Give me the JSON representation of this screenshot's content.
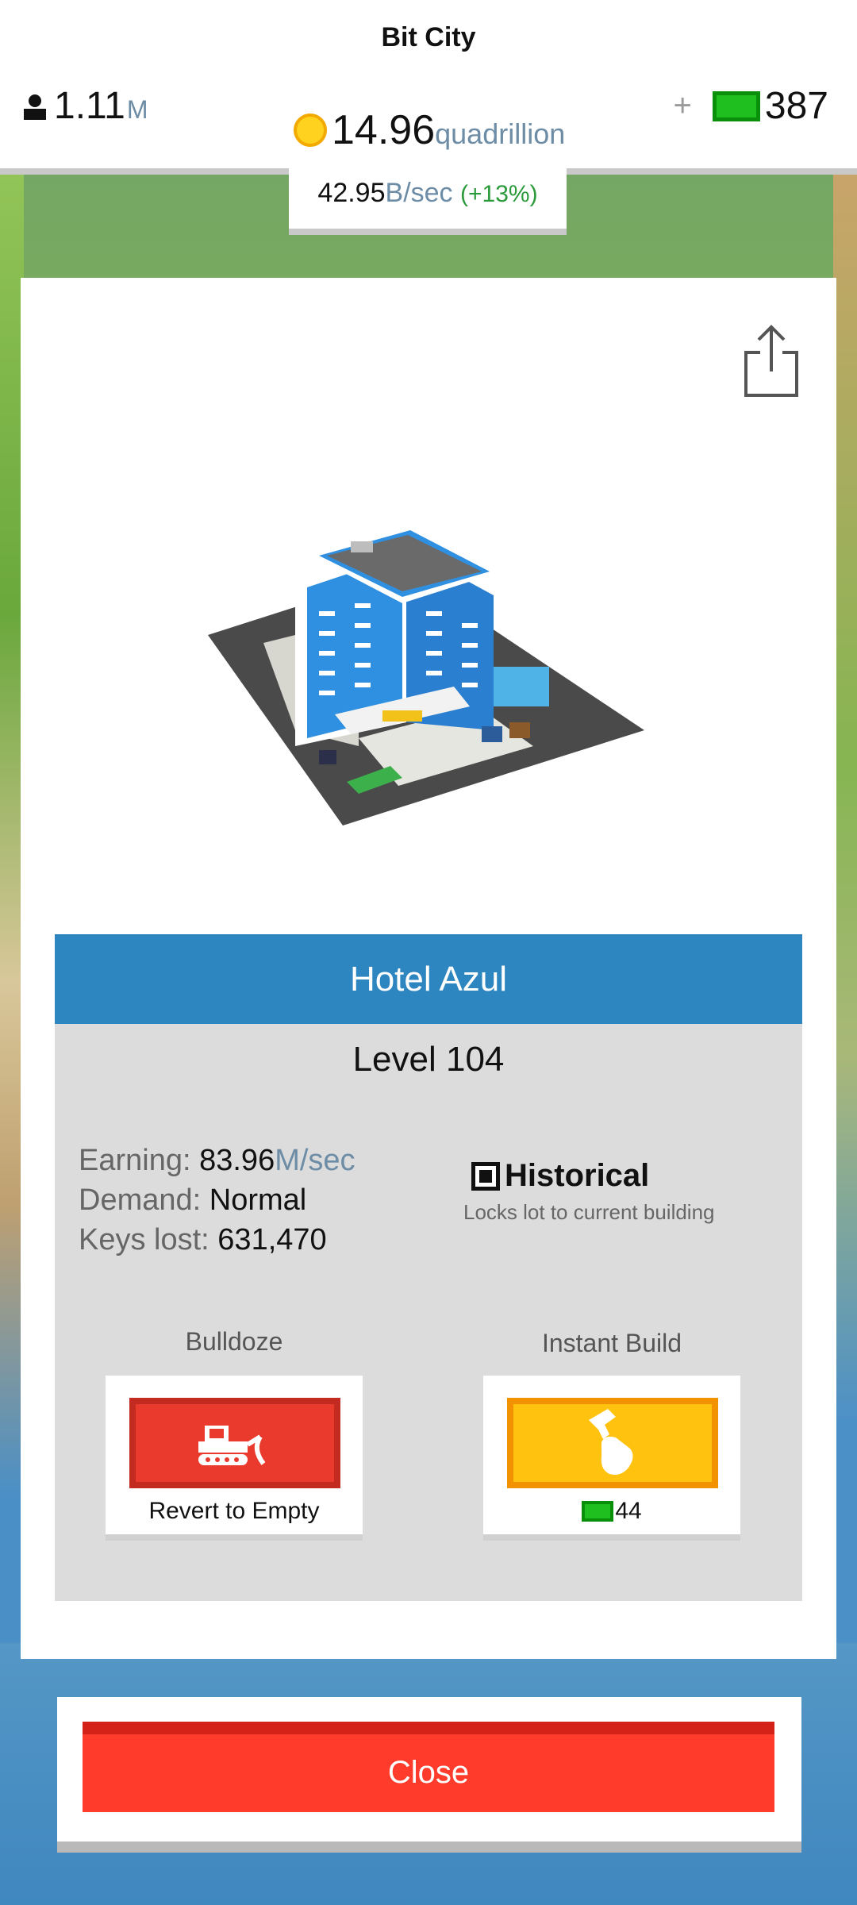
{
  "app": {
    "title": "Bit City"
  },
  "hud": {
    "population_value": "1.11",
    "population_unit": "M",
    "coins_value": "14.96",
    "coins_unit": "quadrillion",
    "bux_plus": "+",
    "bux_value": "387",
    "rate_value": "42.95",
    "rate_unit": "B/sec",
    "rate_bonus": "(+13%)"
  },
  "building": {
    "name": "Hotel Azul",
    "level": "Level 104",
    "earning_label": "Earning:",
    "earning_value": "83.96",
    "earning_unit": "M/sec",
    "demand_label": "Demand:",
    "demand_value": "Normal",
    "keys_label": "Keys lost:",
    "keys_value": "631,470",
    "historical_label": "Historical",
    "historical_desc": "Locks lot to current building"
  },
  "actions": {
    "bulldoze_label": "Bulldoze",
    "bulldoze_caption": "Revert to Empty",
    "instant_label": "Instant Build",
    "instant_cost": "44"
  },
  "footer": {
    "close_label": "Close"
  },
  "colors": {
    "header_blue": "#2e86c1",
    "bulldoze_red": "#ea3a2e",
    "instant_yellow": "#ffc20e",
    "close_red": "#ff3b2b",
    "bux_green": "#1fbf1f"
  }
}
